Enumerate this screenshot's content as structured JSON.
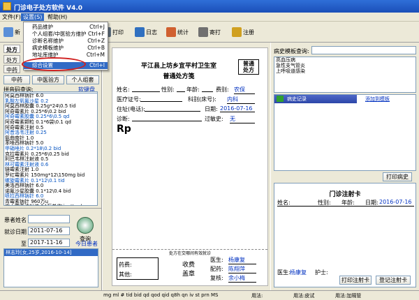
{
  "window": {
    "title": "门诊电子处方软件 V4.0"
  },
  "menu": {
    "file": "文件(F)",
    "settings": "设置(S)",
    "help": "帮助(H)"
  },
  "dropdown": [
    {
      "label": "药品维护",
      "shortcut": "Ctrl+J"
    },
    {
      "label": "个人组套/中医验方维护",
      "shortcut": "Ctrl+F"
    },
    {
      "label": "诊断名称维护",
      "shortcut": "Ctrl+Z"
    },
    {
      "label": "病史模板维护",
      "shortcut": "Ctrl+B"
    },
    {
      "label": "地址库维护",
      "shortcut": "Ctrl+M"
    },
    {
      "label": "综合设置",
      "shortcut": "Ctrl+I"
    }
  ],
  "toolbar": {
    "new_btn": "新",
    "print": "打印",
    "log": "日志",
    "stats": "统计",
    "archive": "寄打",
    "register": "注册",
    "frag1": "处",
    "frag2": "处",
    "frag3": "个"
  },
  "left": {
    "tab1": "处方",
    "tab2": "中药",
    "tab_frag1": "处方",
    "tab_frag2": "药",
    "tab_frag3": "处方",
    "tab_row2a": "处方",
    "tab_row2b": "处方",
    "btn_western": "中药",
    "btn_chinese": "中医验方",
    "btn_personal": "个人组套",
    "search_label": "拼音码查询:",
    "keyboard": "软键盘",
    "drugs": [
      "阿莫西林钠针 6.0",
      "乳酸左氧氟沙星 0.2",
      "阿莫西林胶囊 0.25g*24\\0.5 tid",
      "阿奇霉素片 0.25*6\\0.2 bid",
      "阿奇霉素胶囊 0.25*6\\0.5 qd",
      "阿奇霉素颗粒 0.1*6袋\\0.1 qd",
      "阿奇霉素注射 0.5",
      "阿昔洛韦注射 0.25",
      "氨曲南针 1.0",
      "苯唑西林钠针 5.0",
      "甲硝唑片 0.2*18\\0.2 bid",
      "克拉霉素片 0.25*6\\0.25 bid",
      "利巴韦林注射液 0.5",
      "林可霉素注射液 0.6",
      "链霉素注射 1.0",
      "罗红霉素片 150mg*12\\150mg bid",
      "螺旋霉素片 0.1*12\\0.1 tid",
      "美洛西林钠针 6.0",
      "诺氟沙星胶囊 0.1*12\\0.4 bid",
      "哌拉西林钠针 6.0",
      "青霉素钠针 960万u",
      "庆大霉素注射液 24万单位\\ivgtt qd"
    ],
    "patient_label": "患者姓名",
    "visit_label": "就诊日期",
    "visit_date": "2011-07-16",
    "to_label": "至",
    "to_date": "2017-11-16",
    "query_btn": "查询",
    "today_btn": "今日患者",
    "result": "林志玲[女,25岁,2016-10-14]"
  },
  "rx": {
    "clinic": "平江县上坊乡宜平村卫生室",
    "form": "普通处方笺",
    "badge1": "普通",
    "badge2": "处方",
    "name_l": "姓名:",
    "sex_l": "性别:",
    "age_l": "年龄:",
    "fee_l": "费别:",
    "fee_v": "农保",
    "id_l": "医疗证号:",
    "dept_l": "科别(床号):",
    "dept_v": "内科",
    "addr_l": "住址(电话):",
    "date_l": "日期:",
    "date_v": "2016-07-16",
    "diag_l": "诊断:",
    "allergy_l": "过敏史:",
    "allergy_v": "无",
    "rp": "Rp",
    "footer_note": "处方在交哪间有效就诊",
    "drug_fee": "药费:",
    "other_fee": "其他:",
    "charge": "收费",
    "seal": "盖章",
    "doctor_l": "医生:",
    "doctor_v": "杨康复",
    "pharm_l": "配药:",
    "pharm_v": "陈翔萍",
    "check_l": "复核:",
    "check_v": "余小梅"
  },
  "right": {
    "template_label": "病史模板查询:",
    "template_items": [
      "高血压病",
      "急性支气管炎",
      "上呼吸道感染"
    ],
    "history_band": "病史记录",
    "add_template": "添加到模板",
    "print_history": "打印病史",
    "card_title": "门诊注射卡",
    "card_name": "姓名:",
    "card_sex": "性别:",
    "card_age": "年龄:",
    "card_date_l": "日期:",
    "card_date": "2016-07-16",
    "card_doctor_l": "医生:",
    "card_doctor": "杨康复",
    "card_nurse": "护士:",
    "print_card": "打印注射卡",
    "record_card": "登记注射卡"
  },
  "status": {
    "left": "mg ml # tid bid qd qod qid q8h qn iv st prn MS",
    "usage": "用法:",
    "dosage": "用法:皮试",
    "add": "用法:加隔管",
    "usage2": "用法:",
    "phrase": "用法:双"
  }
}
